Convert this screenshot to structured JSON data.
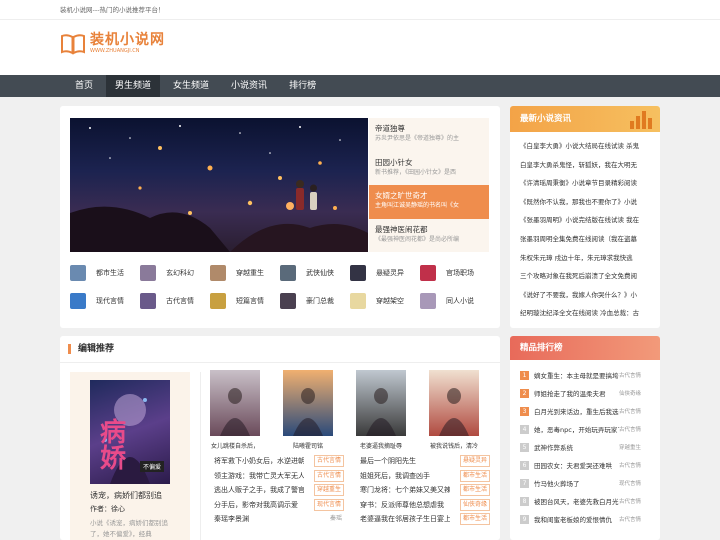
{
  "topbar": {
    "text": "装机小说网---热门的小说推荐平台！"
  },
  "logo": {
    "title": "装机小说网",
    "subtitle": "WWW.ZHUANGJI.CN"
  },
  "nav": {
    "items": [
      "首页",
      "男生频道",
      "女生频道",
      "小说资讯",
      "排行榜"
    ],
    "active": 1
  },
  "slider": {
    "items": [
      {
        "title": "帝道独尊",
        "desc": "苏炎尹依思是《帝道独尊》的主"
      },
      {
        "title": "田园小针女",
        "desc": "新书推荐，《田园小针女》是西"
      },
      {
        "title": "女婿之旷世奇才",
        "desc": "主角叫江诚吴静瑶的书名叫《女"
      },
      {
        "title": "最强神医闹花都",
        "desc": "《最强神医闹花都》是尚必所编"
      }
    ],
    "active": 2
  },
  "categories": [
    {
      "label": "都市生活",
      "color": "#6a8ab0"
    },
    {
      "label": "玄幻科幻",
      "color": "#8a7a9a"
    },
    {
      "label": "穿越重生",
      "color": "#b08a6a"
    },
    {
      "label": "武侠仙侠",
      "color": "#5a6a7a"
    },
    {
      "label": "悬疑灵异",
      "color": "#333344"
    },
    {
      "label": "官场职场",
      "color": "#c0304a"
    },
    {
      "label": "现代言情",
      "color": "#3a7ac8"
    },
    {
      "label": "古代言情",
      "color": "#6a5a8a"
    },
    {
      "label": "短篇言情",
      "color": "#c8a040"
    },
    {
      "label": "豪门总裁",
      "color": "#4a4050"
    },
    {
      "label": "穿越架空",
      "color": "#e8d8a0"
    },
    {
      "label": "同人小说",
      "color": "#a898b8"
    }
  ],
  "editor": {
    "title": "编辑推荐",
    "featured": {
      "title": "诱宠，病娇们都别追",
      "author": "作者：徐心",
      "desc": "小说《诱宠，病娇们都别追了，她不偏爱》，经典",
      "cover_text": "病娇",
      "cover_badge": "不偏爱"
    },
    "covers": [
      {
        "title": "女儿跳楼自杀后，",
        "color1": "#c9c0c8",
        "color2": "#6a4a5a"
      },
      {
        "title": "陆曦霍司铭",
        "color1": "#f0b070",
        "color2": "#2a4a7a"
      },
      {
        "title": "老婆逼我摘耻辱",
        "color1": "#c0c8d0",
        "color2": "#3a3a3a"
      },
      {
        "title": "被我说钱后，清冷",
        "color1": "#f0e0d0",
        "color2": "#b04a40"
      }
    ],
    "list": [
      {
        "name": "将军救下小奶女后，水逆进朝",
        "tag": "古代言情",
        "gray": false
      },
      {
        "name": "最后一个阴阳先生",
        "tag": "悬疑灵异",
        "gray": false
      },
      {
        "name": "领主游戏：我带亡灵大军无人",
        "tag": "古代言情",
        "gray": false
      },
      {
        "name": "姐姐死后，我调查凶手",
        "tag": "都市生活",
        "gray": false
      },
      {
        "name": "逃出人贩子之手，我成了警官",
        "tag": "穿越重生",
        "gray": false
      },
      {
        "name": "寒门龙将：七个弟妹又美又辣",
        "tag": "都市生活",
        "gray": false
      },
      {
        "name": "分手后，影帝对我高调示爱",
        "tag": "现代言情",
        "gray": false
      },
      {
        "name": "穿书：反派师尊他总想虐我",
        "tag": "仙侠奇缘",
        "gray": false
      },
      {
        "name": "秦瑶李景渊",
        "tag": "秦瑶",
        "gray": true
      },
      {
        "name": "老婆逼我在邻居孩子生日宴上",
        "tag": "都市生活",
        "gray": false
      }
    ]
  },
  "news": {
    "title": "最新小说资讯",
    "items": [
      "《白皇李大勇》小说大结局在线试读 杀鬼",
      "白皇李大勇杀鬼怪，斩狐妖，我在大明无",
      "《许清瑶周秉衡》小说章节目录精彩阅读",
      "《既然你不认我，那我也不要你了》小说",
      "《张墨羽周明》小说完结版在线试读 我在",
      "张墨羽周明全集免费在线阅读（我在盗墓",
      "朱权朱元璋 戍边十年，朱元璋求我快逃",
      "三个攻略对象在我死后崩溃了全文免费阅",
      "《说好了不要我，我嫁人你哭什么？》小",
      "纪明璇沈纪泽全文在线阅读 冷血总裁：古"
    ]
  },
  "ranking": {
    "title": "精品排行榜",
    "items": [
      {
        "name": "嫡女重生：本主母就是要搞垮",
        "genre": "古代言情"
      },
      {
        "name": "师姐抢走了我的温柔夫君",
        "genre": "仙侠奇缘"
      },
      {
        "name": "白月光到来话边，重生后我选",
        "genre": "古代言情"
      },
      {
        "name": "她，恶毒npc，开始玩弄玩家了",
        "genre": "古代言情"
      },
      {
        "name": "武神作弊系统",
        "genre": "穿越重生"
      },
      {
        "name": "田园农女：夫君爱哭还难哄",
        "genre": "古代言情"
      },
      {
        "name": "竹马他火葬场了",
        "genre": "现代言情"
      },
      {
        "name": "被困台风天，老婆先救白月光",
        "genre": "古代言情"
      },
      {
        "name": "我和闺蜜老板娘的爱恨情仇",
        "genre": "古代言情"
      }
    ]
  }
}
